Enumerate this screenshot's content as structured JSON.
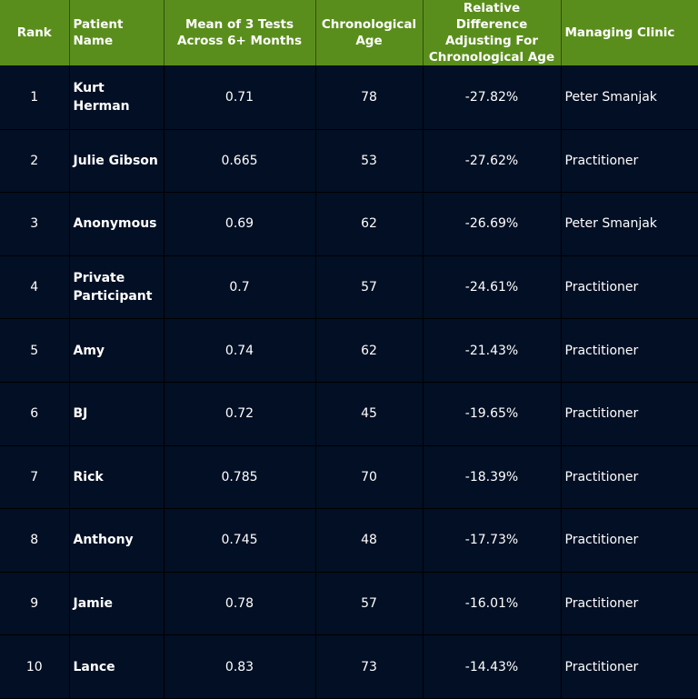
{
  "chart_data": {
    "type": "table",
    "columns": [
      "Rank",
      "Patient Name",
      "Mean of 3 Tests Across 6+ Months",
      "Chronological Age",
      "Relative Difference Adjusting For Chronological Age",
      "Managing Clinic"
    ],
    "rows": [
      [
        "1",
        "Kurt Herman",
        "0.71",
        "78",
        "-27.82%",
        "Peter Smanjak"
      ],
      [
        "2",
        "Julie Gibson",
        "0.665",
        "53",
        "-27.62%",
        "Practitioner"
      ],
      [
        "3",
        "Anonymous",
        "0.69",
        "62",
        "-26.69%",
        "Peter Smanjak"
      ],
      [
        "4",
        "Private Participant",
        "0.7",
        "57",
        "-24.61%",
        "Practitioner"
      ],
      [
        "5",
        "Amy",
        "0.74",
        "62",
        "-21.43%",
        "Practitioner"
      ],
      [
        "6",
        "BJ",
        "0.72",
        "45",
        "-19.65%",
        "Practitioner"
      ],
      [
        "7",
        "Rick",
        "0.785",
        "70",
        "-18.39%",
        "Practitioner"
      ],
      [
        "8",
        "Anthony",
        "0.745",
        "48",
        "-17.73%",
        "Practitioner"
      ],
      [
        "9",
        "Jamie",
        "0.78",
        "57",
        "-16.01%",
        "Practitioner"
      ],
      [
        "10",
        "Lance",
        "0.83",
        "73",
        "-14.43%",
        "Practitioner"
      ]
    ]
  },
  "colors": {
    "header_bg": "#5a8e1c",
    "body_bg": "#020f24",
    "text": "#ffffff"
  }
}
